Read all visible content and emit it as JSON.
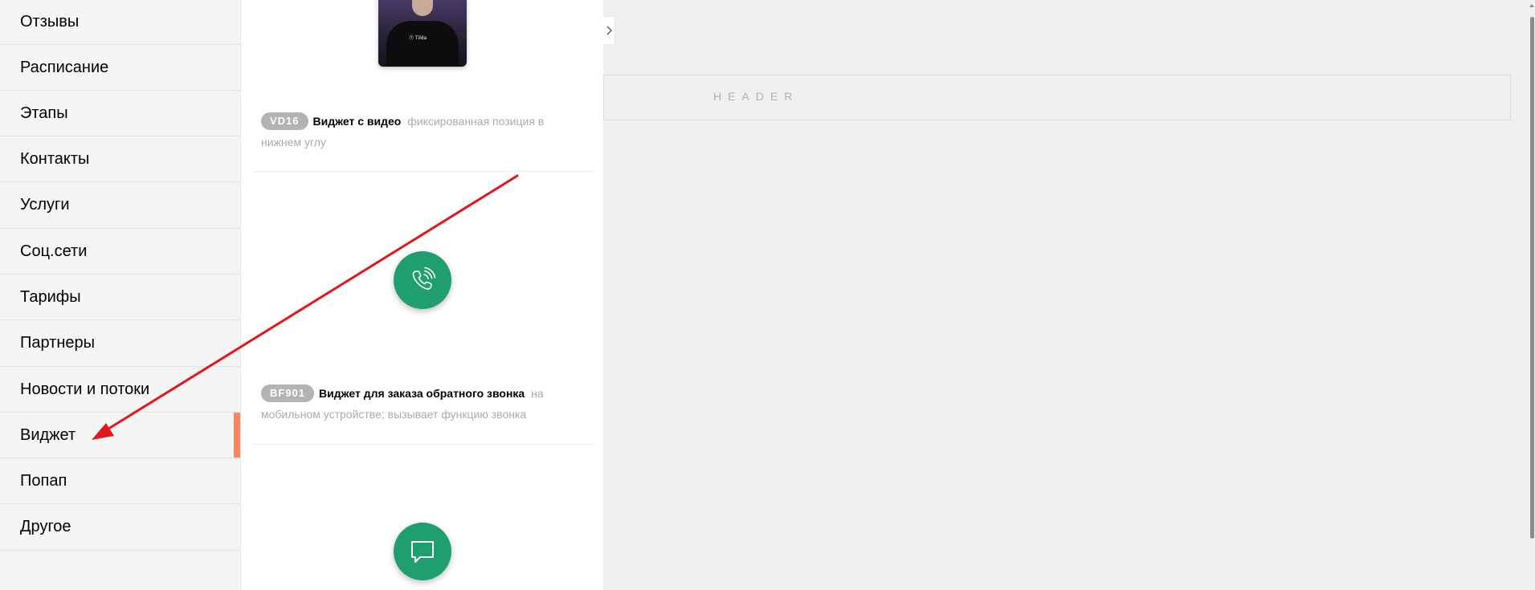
{
  "sidebar": {
    "items": [
      {
        "label": "Отзывы"
      },
      {
        "label": "Расписание"
      },
      {
        "label": "Этапы"
      },
      {
        "label": "Контакты"
      },
      {
        "label": "Услуги"
      },
      {
        "label": "Соц.сети"
      },
      {
        "label": "Тарифы"
      },
      {
        "label": "Партнеры"
      },
      {
        "label": "Новости и потоки"
      },
      {
        "label": "Виджет",
        "active": true
      },
      {
        "label": "Попап"
      },
      {
        "label": "Другое"
      }
    ],
    "active_color": "#ff8562"
  },
  "blocks": [
    {
      "code": "VD16",
      "title": "Виджет с видео",
      "description": "фиксированная позиция в нижнем углу",
      "thumbnail_icon": "video-person-thumbnail",
      "thumbnail_logo": "Tilda"
    },
    {
      "code": "BF901",
      "title": "Виджет для заказа обратного звонка",
      "description": "на мобильном устройстве; вызывает функцию звонка",
      "thumbnail_icon": "phone-call-icon",
      "button_color": "#1f9f6d"
    },
    {
      "thumbnail_icon": "chat-bubble-icon",
      "button_color": "#1f9f6d"
    }
  ],
  "canvas": {
    "header_label": "HEADER"
  },
  "annotation": {
    "arrow_color": "#e3161b"
  }
}
